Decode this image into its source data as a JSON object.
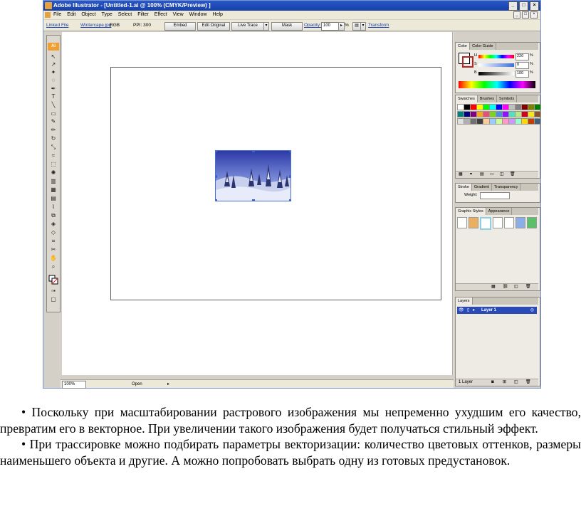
{
  "window": {
    "title": "Adobe Illustrator - [Untitled-1.ai @ 100% (CMYK/Preview) ]",
    "minimize": "_",
    "maximize": "□",
    "close": "×"
  },
  "menu": [
    "File",
    "Edit",
    "Object",
    "Type",
    "Select",
    "Filter",
    "Effect",
    "View",
    "Window",
    "Help"
  ],
  "control_bar": {
    "linked_file": "Linked File",
    "file_name": "Wintercape.jpg",
    "color_mode": "RGB",
    "ppi": "PPI: 300",
    "embed": "Embed",
    "edit_original": "Edit Original",
    "live_trace": "Live Trace",
    "mask": "Mask",
    "opacity_label": "Opacity:",
    "opacity_value": "100",
    "percent": "%",
    "transform": "Transform"
  },
  "color_panel": {
    "tabs": [
      "Color",
      "Color Guide"
    ],
    "channels": [
      {
        "label": "H",
        "value": "220"
      },
      {
        "label": "S",
        "value": "0"
      },
      {
        "label": "B",
        "value": "100"
      }
    ],
    "unit": "%"
  },
  "swatches_panel": {
    "tabs": [
      "Swatches",
      "Brushes",
      "Symbols"
    ]
  },
  "stroke_panel": {
    "tabs": [
      "Stroke",
      "Gradient",
      "Transparency"
    ],
    "weight_label": "Weight:"
  },
  "graphic_styles_panel": {
    "tabs": [
      "Graphic Styles",
      "Appearance"
    ]
  },
  "layers_panel": {
    "tabs": [
      "Layers"
    ],
    "layer_name": "Layer 1",
    "footer": "1 Layer"
  },
  "status_bar": {
    "zoom": "100%",
    "status_text": "Open"
  },
  "caption": {
    "p1": "• Поскольку при масштабировании растрового изображения мы непременно ухудшим его качество, превратим его в векторное. При увеличении такого изображения будет получаться стильный эффект.",
    "p2": "• При трассировке можно подбирать параметры векторизации: количество цветовых оттенков, размеры наименьшего объекта и другие. А можно попробовать выбрать одну из готовых предустановок."
  },
  "colors": {
    "title_bar": "#1a46b8",
    "selection": "#3a62d6",
    "accent_orange": "#f0a030",
    "layer_highlight": "#2a4ab8"
  },
  "icons": [
    "illustrator-logo-icon",
    "selection-tool-icon",
    "direct-selection-tool-icon",
    "pen-tool-icon",
    "type-tool-icon",
    "line-tool-icon",
    "rectangle-tool-icon",
    "paintbrush-tool-icon",
    "pencil-tool-icon",
    "rotate-tool-icon",
    "scale-tool-icon",
    "warp-tool-icon",
    "symbol-sprayer-tool-icon",
    "graph-tool-icon",
    "mesh-tool-icon",
    "gradient-tool-icon",
    "eyedropper-tool-icon",
    "blend-tool-icon",
    "live-paint-tool-icon",
    "slice-tool-icon",
    "scissors-tool-icon",
    "hand-tool-icon",
    "zoom-tool-icon",
    "fill-stroke-icon",
    "screen-mode-icon"
  ]
}
